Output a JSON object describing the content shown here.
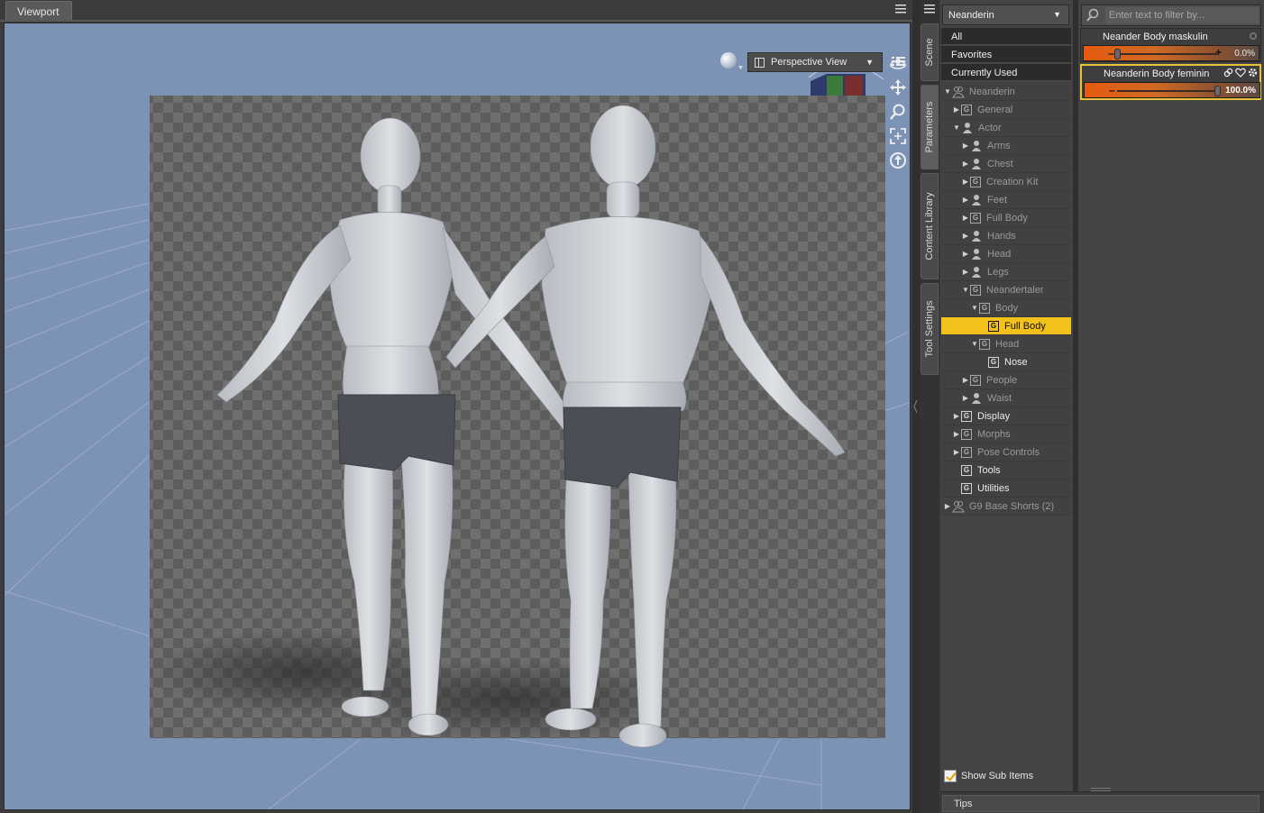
{
  "viewport": {
    "tab_label": "Viewport",
    "view_select": "Perspective View"
  },
  "side_tabs": [
    "Scene",
    "Parameters",
    "Content Library",
    "Tool Settings"
  ],
  "tree": {
    "node_select": "Neanderin",
    "filters": [
      "All",
      "Favorites",
      "Currently Used"
    ],
    "rows": [
      {
        "label": "Neanderin"
      },
      {
        "label": "General"
      },
      {
        "label": "Actor"
      },
      {
        "label": "Arms"
      },
      {
        "label": "Chest"
      },
      {
        "label": "Creation Kit"
      },
      {
        "label": "Feet"
      },
      {
        "label": "Full Body"
      },
      {
        "label": "Hands"
      },
      {
        "label": "Head"
      },
      {
        "label": "Legs"
      },
      {
        "label": "Neandertaler"
      },
      {
        "label": "Body"
      },
      {
        "label": "Full Body"
      },
      {
        "label": "Head"
      },
      {
        "label": "Nose"
      },
      {
        "label": "People"
      },
      {
        "label": "Waist"
      },
      {
        "label": "Display"
      },
      {
        "label": "Morphs"
      },
      {
        "label": "Pose Controls"
      },
      {
        "label": "Tools"
      },
      {
        "label": "Utilities"
      },
      {
        "label": "G9 Base Shorts (2)"
      }
    ],
    "show_sub_items": "Show Sub Items"
  },
  "properties": {
    "filter_placeholder": "Enter text to filter by...",
    "sliders": [
      {
        "name": "Neander Body maskulin",
        "value_text": "0.0%",
        "value": 0
      },
      {
        "name": "Neanderin Body feminin",
        "value_text": "100.0%",
        "value": 1
      }
    ]
  },
  "bottom": {
    "tips_label": "Tips"
  },
  "colors": {
    "accent": "#f2c21b",
    "slider": "#e55a10",
    "viewport_bg": "#7c93b6"
  }
}
